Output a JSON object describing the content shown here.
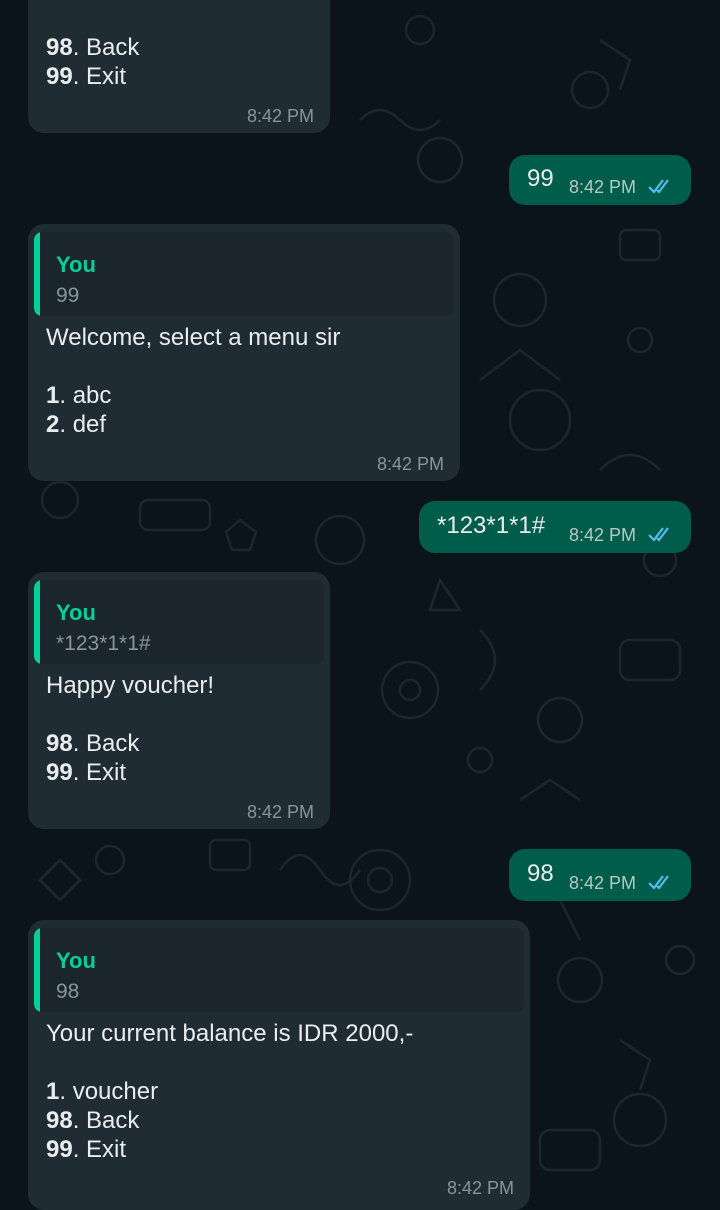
{
  "colors": {
    "background": "#0b141a",
    "incoming_bubble": "#202c33",
    "outgoing_bubble": "#005c4b",
    "quote_accent": "#06cf9c",
    "read_ticks": "#53bdeb"
  },
  "messages": {
    "m1": {
      "lines": [
        {
          "num": "98",
          "text": ". Back"
        },
        {
          "num": "99",
          "text": ". Exit"
        }
      ],
      "time": "8:42 PM"
    },
    "m2": {
      "text": "99",
      "time": "8:42 PM",
      "status_icon": "double-check-read-icon"
    },
    "m3": {
      "quote_author": "You",
      "quote_text": "99",
      "body": "Welcome, select a menu sir",
      "lines": [
        {
          "num": "1",
          "text": ". abc"
        },
        {
          "num": "2",
          "text": ". def"
        }
      ],
      "time": "8:42 PM"
    },
    "m4": {
      "text": "*123*1*1#",
      "time": "8:42 PM",
      "status_icon": "double-check-read-icon"
    },
    "m5": {
      "quote_author": "You",
      "quote_text": "*123*1*1#",
      "body": "Happy voucher!",
      "lines": [
        {
          "num": "98",
          "text": ". Back"
        },
        {
          "num": "99",
          "text": ". Exit"
        }
      ],
      "time": "8:42 PM"
    },
    "m6": {
      "text": "98",
      "time": "8:42 PM",
      "status_icon": "double-check-read-icon"
    },
    "m7": {
      "quote_author": "You",
      "quote_text": "98",
      "body": "Your current balance is IDR 2000,-",
      "lines": [
        {
          "num": "1",
          "text": ". voucher"
        },
        {
          "num": "98",
          "text": ". Back"
        },
        {
          "num": "99",
          "text": ". Exit"
        }
      ],
      "time": "8:42 PM"
    }
  }
}
